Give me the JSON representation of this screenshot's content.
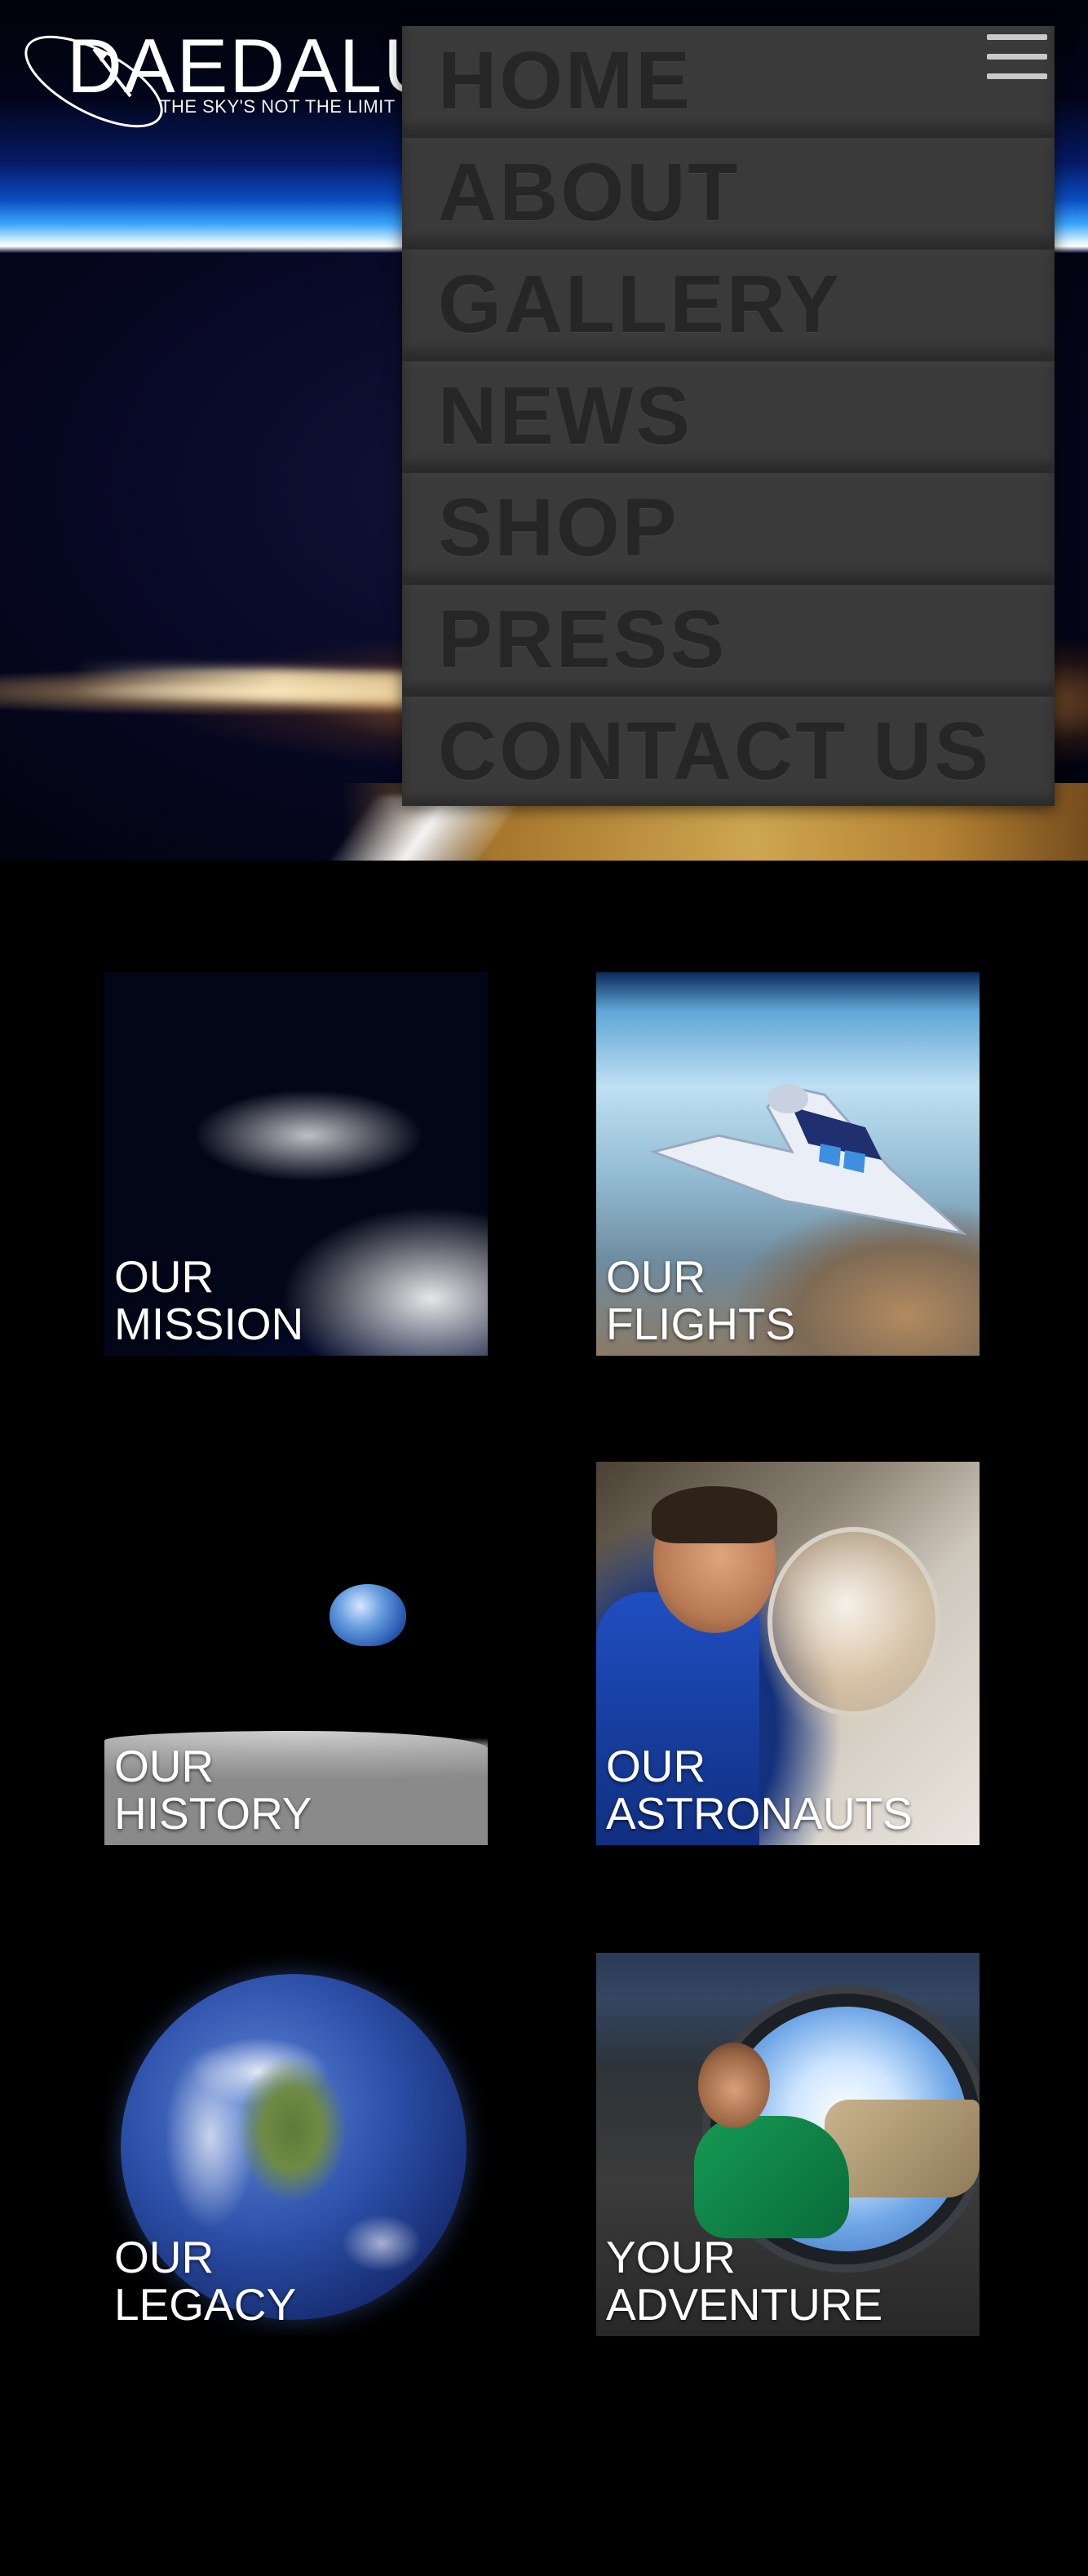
{
  "brand": {
    "name": "DAEDALU",
    "tagline": "THE SKY'S NOT THE LIMIT"
  },
  "menu": {
    "items": [
      {
        "label": "HOME"
      },
      {
        "label": "ABOUT"
      },
      {
        "label": "GALLERY"
      },
      {
        "label": "NEWS"
      },
      {
        "label": "SHOP"
      },
      {
        "label": "PRESS"
      },
      {
        "label": "CONTACT US"
      }
    ],
    "toggle_icon": "hamburger-icon"
  },
  "tiles": [
    {
      "line1": "OUR",
      "line2": "MISSION"
    },
    {
      "line1": "OUR",
      "line2": "FLIGHTS"
    },
    {
      "line1": "OUR",
      "line2": "HISTORY"
    },
    {
      "line1": "OUR",
      "line2": "ASTRONAUTS"
    },
    {
      "line1": "OUR",
      "line2": "LEGACY"
    },
    {
      "line1": "YOUR",
      "line2": "ADVENTURE"
    }
  ],
  "colors": {
    "background": "#000000",
    "menu_bg": "#3a3a3a",
    "menu_text": "#262626",
    "tile_text": "#ffffff"
  }
}
